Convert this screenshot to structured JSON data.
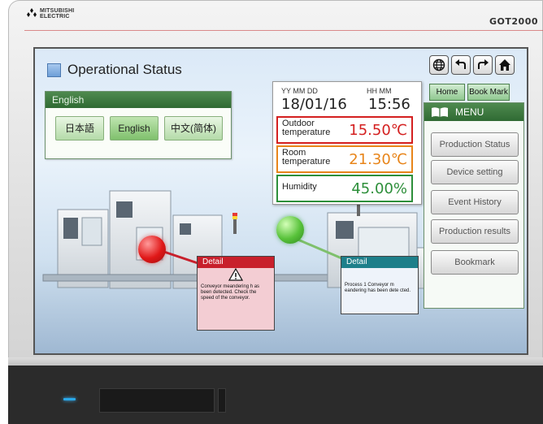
{
  "device": {
    "brand_line1": "MITSUBISHI",
    "brand_line2": "ELECTRIC",
    "model": "GOT2000"
  },
  "screen": {
    "title": "Operational Status",
    "language_panel": {
      "header": "English",
      "buttons": [
        "日本語",
        "English",
        "中文(简体)"
      ],
      "selected": "English"
    },
    "nav_icons": [
      "globe-icon",
      "back-arrow-icon",
      "forward-arrow-icon",
      "home-icon"
    ],
    "top_buttons": {
      "home": "Home",
      "bookmark": "Book Mark"
    },
    "clock": {
      "header_date": "YY  MM  DD",
      "header_time": "HH  MM",
      "date": "18/01/16",
      "time": "15:56"
    },
    "measurements": [
      {
        "label": "Outdoor temperature",
        "value": "15.50℃",
        "color": "#d42020"
      },
      {
        "label": "Room temperature",
        "value": "21.30℃",
        "color": "#e8851a"
      },
      {
        "label": "Humidity",
        "value": "45.00%",
        "color": "#2d8f3a"
      }
    ],
    "menu": {
      "title": "MENU",
      "items": [
        "Production Status",
        "Device setting",
        "Event History",
        "Production results",
        "Bookmark"
      ]
    },
    "details": [
      {
        "header": "Detail",
        "text": "Conveyor meandering h as been detected. Check the speed of the conveyor.",
        "color": "#c8202c"
      },
      {
        "header": "Detail",
        "text": "Process 1 Conveyor m eandering has been dete cted.",
        "color": "#1e7f8a"
      }
    ]
  }
}
